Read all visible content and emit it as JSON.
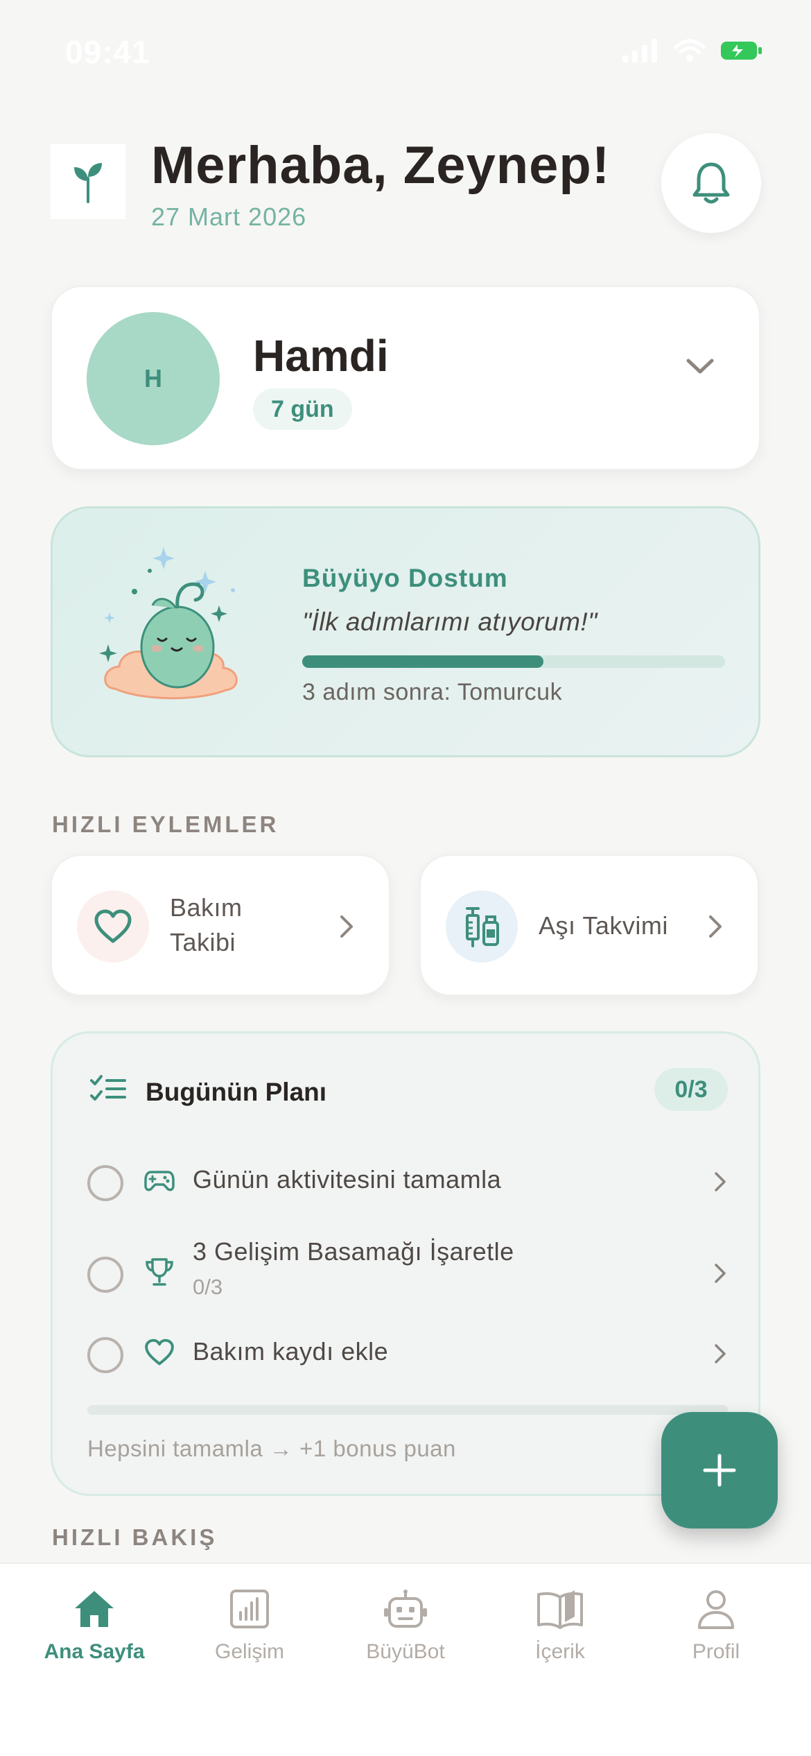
{
  "status_bar": {
    "time": "09:41"
  },
  "header": {
    "greeting": "Merhaba, Zeynep!",
    "date": "27 Mart 2026",
    "notification_icon": "bell-icon"
  },
  "child": {
    "initial": "H",
    "name": "Hamdi",
    "age": "7 gün"
  },
  "buddy": {
    "title": "Büyüyo Dostum",
    "quote": "\"İlk adımlarımı atıyorum!\"",
    "progress": 0.57,
    "next_stage": "3 adım sonra: Tomurcuk"
  },
  "quick_actions": {
    "section_title": "HIZLI EYLEMLER",
    "items": [
      {
        "label_line1": "Bakım",
        "label_line2": "Takibi",
        "icon": "heart-icon"
      },
      {
        "label": "Aşı Takvimi",
        "icon": "vaccine-icon"
      }
    ]
  },
  "plan": {
    "title": "Bugünün Planı",
    "count": "0/3",
    "tasks": [
      {
        "label": "Günün aktivitesini tamamla",
        "icon": "gamepad-icon"
      },
      {
        "label": "3 Gelişim Basamağı İşaretle",
        "sub": "0/3",
        "icon": "trophy-icon"
      },
      {
        "label": "Bakım kaydı ekle",
        "icon": "heart-icon"
      }
    ],
    "progress": 0,
    "footer": "Hepsini tamamla → +1 bonus puan"
  },
  "quick_look": {
    "section_title": "HIZLI BAKIŞ"
  },
  "tabbar": {
    "tabs": [
      {
        "label": "Ana Sayfa",
        "icon": "home-icon",
        "active": true
      },
      {
        "label": "Gelişim",
        "icon": "chart-icon"
      },
      {
        "label": "BüyüBot",
        "icon": "robot-icon"
      },
      {
        "label": "İçerik",
        "icon": "book-icon"
      },
      {
        "label": "Profil",
        "icon": "person-icon"
      }
    ]
  },
  "colors": {
    "accent": "#3d8f7c",
    "accent_light": "#a8d8c6",
    "background": "#f6f6f5",
    "muted_text": "#8d857f"
  }
}
